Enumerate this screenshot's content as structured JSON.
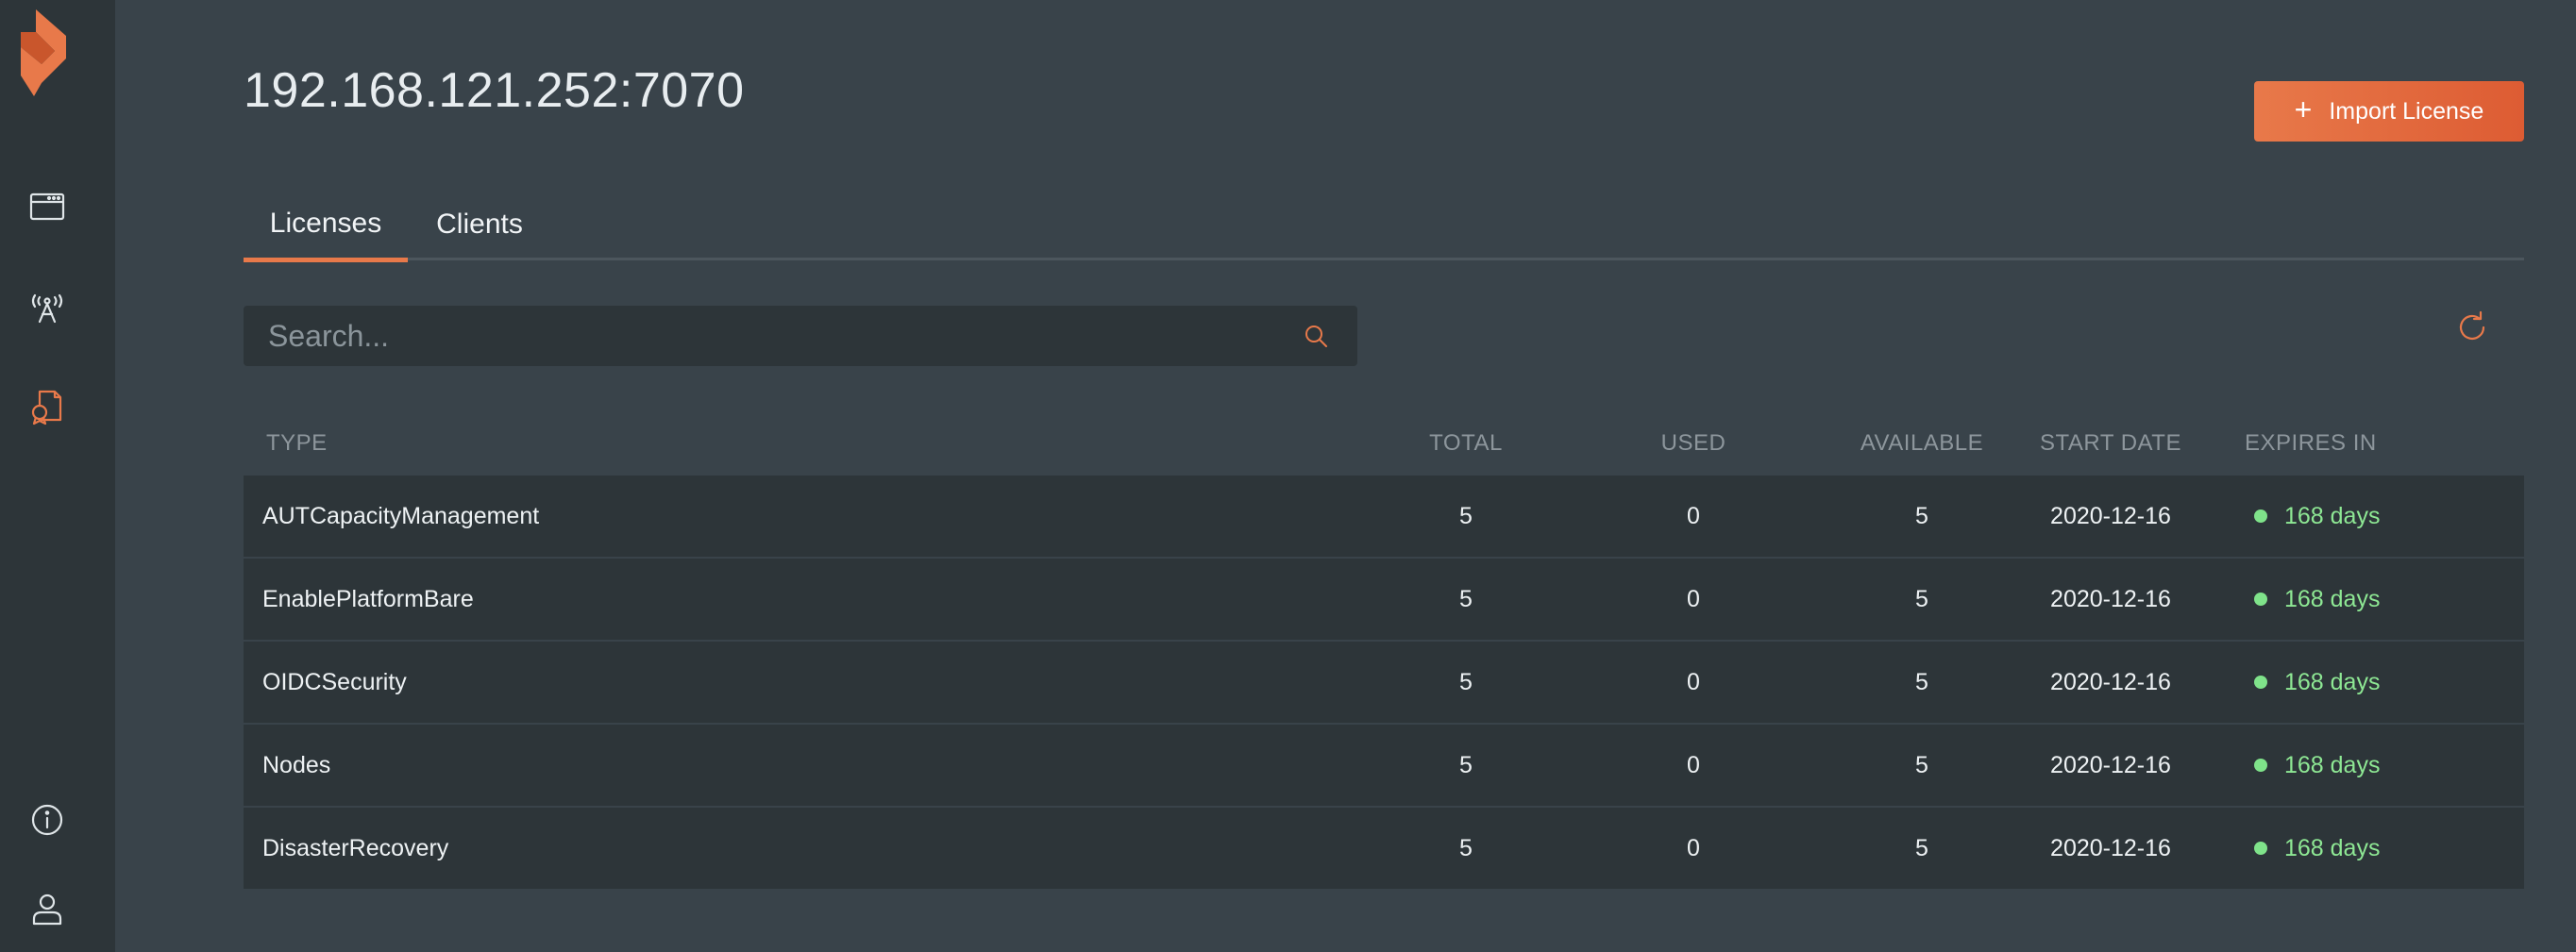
{
  "sidebar": {
    "brand_color": "#e8794a",
    "items": [
      {
        "name": "browser-window-icon"
      },
      {
        "name": "broadcast-tower-icon"
      },
      {
        "name": "license-document-icon",
        "active": true
      },
      {
        "name": "info-icon"
      },
      {
        "name": "user-icon"
      }
    ]
  },
  "header": {
    "title": "192.168.121.252:7070",
    "import_button_label": "Import License"
  },
  "tabs": [
    {
      "label": "Licenses",
      "active": true
    },
    {
      "label": "Clients",
      "active": false
    }
  ],
  "search": {
    "placeholder": "Search...",
    "value": ""
  },
  "table": {
    "columns": [
      "TYPE",
      "TOTAL",
      "USED",
      "AVAILABLE",
      "START DATE",
      "EXPIRES IN"
    ],
    "rows": [
      {
        "type": "AUTCapacityManagement",
        "total": "5",
        "used": "0",
        "available": "5",
        "start_date": "2020-12-16",
        "expires_in": "168 days"
      },
      {
        "type": "EnablePlatformBare",
        "total": "5",
        "used": "0",
        "available": "5",
        "start_date": "2020-12-16",
        "expires_in": "168 days"
      },
      {
        "type": "OIDCSecurity",
        "total": "5",
        "used": "0",
        "available": "5",
        "start_date": "2020-12-16",
        "expires_in": "168 days"
      },
      {
        "type": "Nodes",
        "total": "5",
        "used": "0",
        "available": "5",
        "start_date": "2020-12-16",
        "expires_in": "168 days"
      },
      {
        "type": "DisasterRecovery",
        "total": "5",
        "used": "0",
        "available": "5",
        "start_date": "2020-12-16",
        "expires_in": "168 days"
      }
    ]
  },
  "colors": {
    "accent": "#e8794a",
    "status_ok": "#7fe38a",
    "background": "#39434a",
    "sidebar": "#2d3539"
  }
}
